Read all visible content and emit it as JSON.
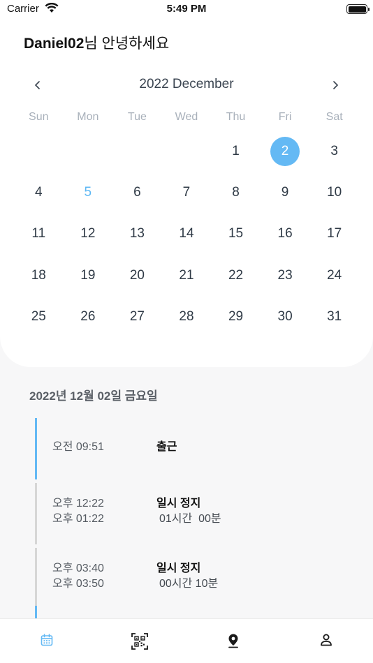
{
  "status_bar": {
    "carrier": "Carrier",
    "time": "5:49 PM"
  },
  "header": {
    "user": "Daniel02",
    "greeting_suffix": "님 안녕하세요"
  },
  "calendar": {
    "month_title": "2022 December",
    "weekdays": [
      "Sun",
      "Mon",
      "Tue",
      "Wed",
      "Thu",
      "Fri",
      "Sat"
    ],
    "leading_blanks": 4,
    "days_in_month": 31,
    "today": 5,
    "selected": 2
  },
  "schedule": {
    "date_heading": "2022년 12월 02일 금요일",
    "entries": [
      {
        "times": [
          "오전 09:51"
        ],
        "label": "출근",
        "duration": "",
        "active": true
      },
      {
        "times": [
          "오후 12:22",
          "오후 01:22"
        ],
        "label": "일시 정지",
        "duration": "01시간  00분",
        "active": false
      },
      {
        "times": [
          "오후 03:40",
          "오후 03:50"
        ],
        "label": "일시 정지",
        "duration": "00시간 10분",
        "active": false
      }
    ]
  },
  "tabs": [
    {
      "name": "tab-calendar",
      "icon": "calendar-icon",
      "active": true
    },
    {
      "name": "tab-qr",
      "icon": "qr-code-icon",
      "active": false
    },
    {
      "name": "tab-location",
      "icon": "location-pin-icon",
      "active": false
    },
    {
      "name": "tab-profile",
      "icon": "person-icon",
      "active": false
    }
  ],
  "colors": {
    "accent": "#64b9f4",
    "today": "#5eb8f4",
    "inactive_icon": "#1a1a1a"
  }
}
